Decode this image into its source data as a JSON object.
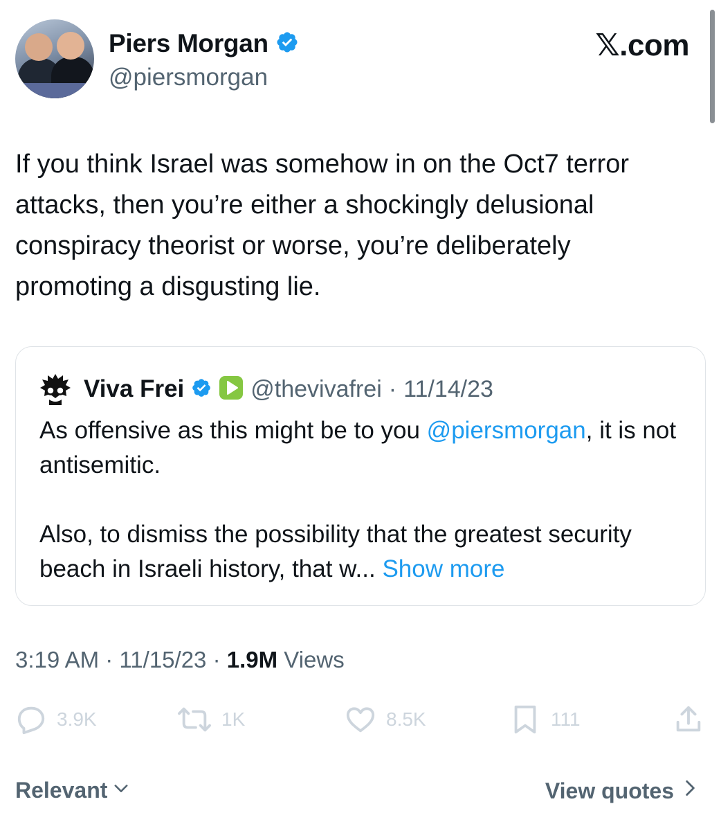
{
  "author": {
    "display_name": "Piers Morgan",
    "handle": "@piersmorgan",
    "verified_icon": "verified-badge-icon"
  },
  "site_logo": "𝕏.com",
  "tweet": {
    "text": "If you think Israel was somehow in on the Oct7 terror attacks, then you’re either a shockingly delusional conspiracy theorist or worse, you’re deliberately promoting a disgusting lie."
  },
  "quoted_tweet": {
    "display_name": "Viva Frei",
    "handle": "@thevivafrei",
    "separator": "·",
    "date": "11/14/23",
    "para1_before": "As offensive as this might be to you ",
    "para1_mention": "@piersmorgan",
    "para1_after": ", it is not antisemitic.",
    "para2": "Also, to dismiss the possibility that the greatest security beach in Israeli history, that w...",
    "show_more": "Show more"
  },
  "meta": {
    "time": "3:19 AM",
    "sep1": " · ",
    "date": "11/15/23",
    "sep2": " · ",
    "views_count": "1.9M",
    "views_label": " Views"
  },
  "actions": {
    "replies": "3.9K",
    "reposts": "1K",
    "likes": "8.5K",
    "bookmarks": "111"
  },
  "footer": {
    "sort_label": "Relevant",
    "view_quotes_label": "View quotes"
  },
  "colors": {
    "accent": "#1d9bf0",
    "muted": "#536471",
    "text": "#0f1419",
    "action_icon": "#cdd5dd"
  }
}
